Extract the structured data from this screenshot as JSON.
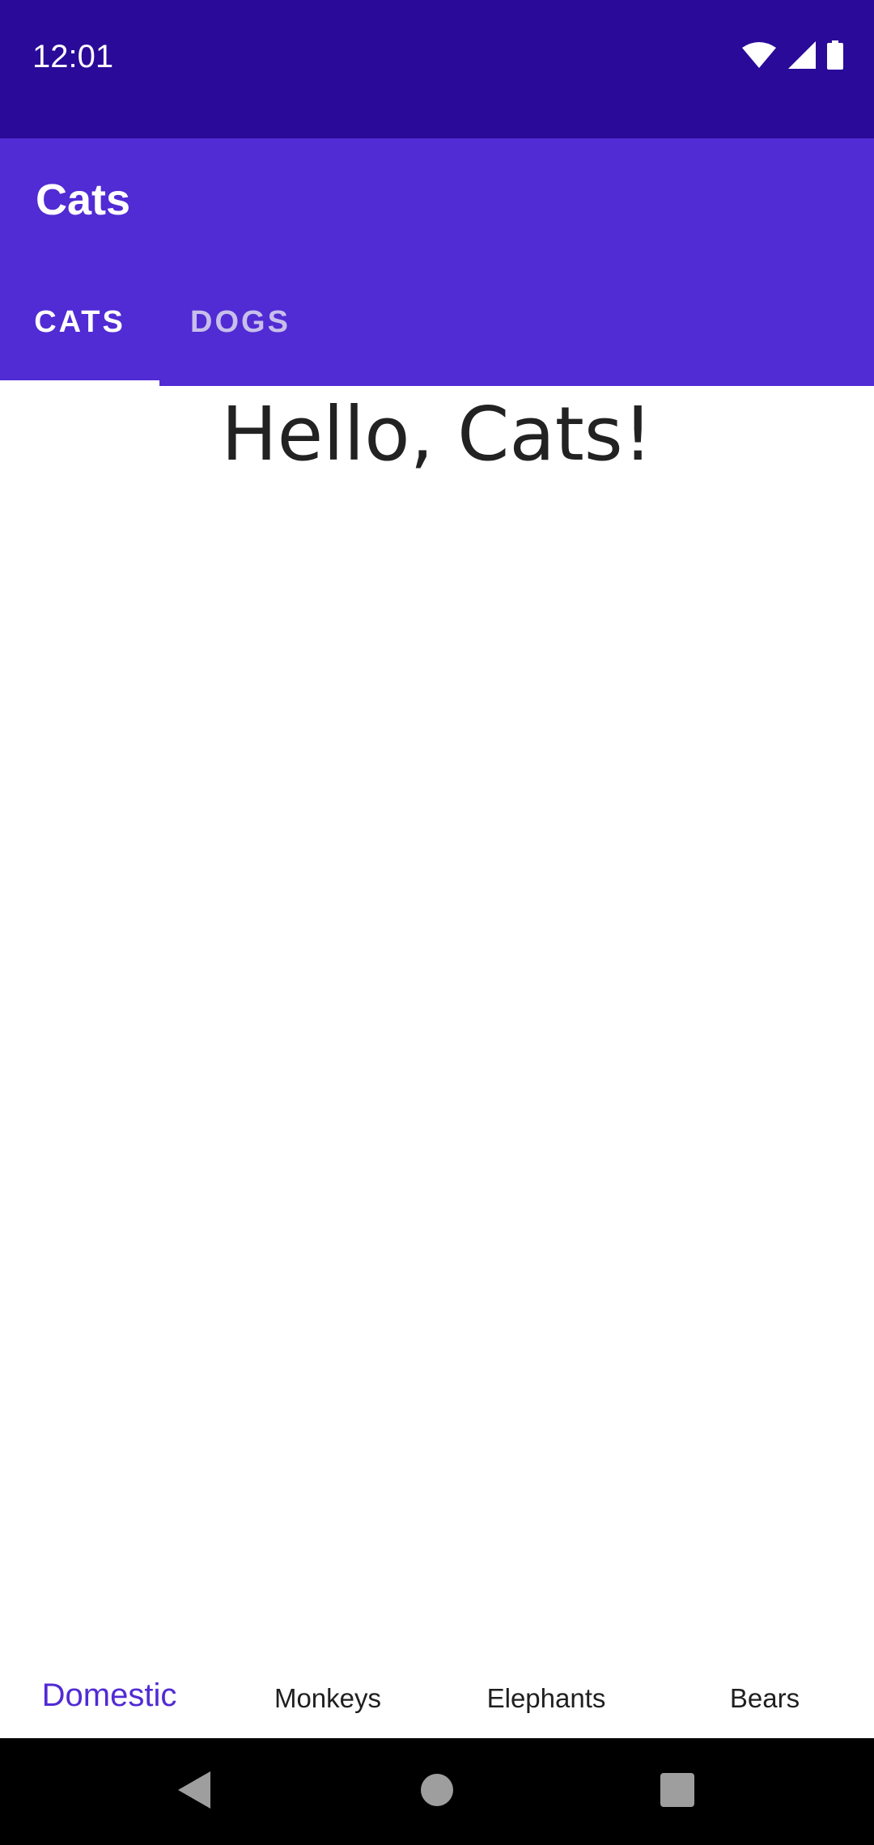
{
  "status_bar": {
    "time": "12:01",
    "icons": [
      "wifi-icon",
      "signal-icon",
      "battery-icon"
    ]
  },
  "app_bar": {
    "title": "Cats",
    "tabs": [
      {
        "label": "CATS",
        "selected": true
      },
      {
        "label": "DOGS",
        "selected": false
      }
    ]
  },
  "content": {
    "greeting": "Hello, Cats!"
  },
  "bottom_nav": {
    "items": [
      {
        "label": "Domestic",
        "selected": true
      },
      {
        "label": "Monkeys",
        "selected": false
      },
      {
        "label": "Elephants",
        "selected": false
      },
      {
        "label": "Bears",
        "selected": false
      }
    ]
  },
  "system_nav": {
    "buttons": [
      "back-icon",
      "home-icon",
      "recents-icon"
    ]
  },
  "colors": {
    "status_bar": "#2a0a99",
    "primary": "#512bd4",
    "unselected_tab": "#c7bfea",
    "text": "#222222"
  }
}
